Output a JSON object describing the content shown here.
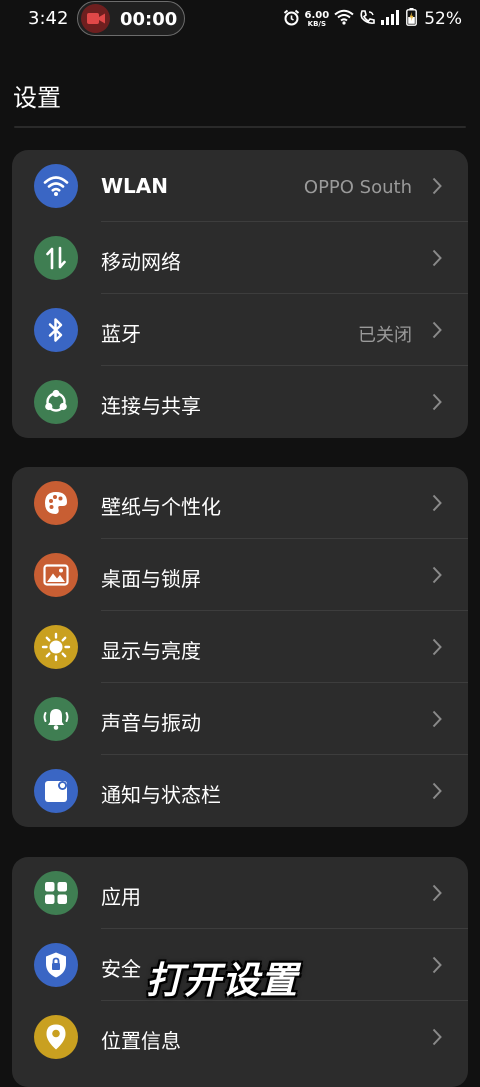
{
  "status_bar": {
    "time": "3:42",
    "recording_time": "00:00",
    "net_speed_value": "6.00",
    "net_speed_unit": "KB/S",
    "battery_percent": "52%",
    "icons": [
      "camera-record-icon",
      "alarm-icon",
      "wifi-signal-icon",
      "wifi-call-icon",
      "cellular-signal-icon",
      "battery-charging-icon"
    ]
  },
  "header": {
    "title": "设置"
  },
  "groups": [
    {
      "items": [
        {
          "label": "WLAN",
          "value": "OPPO South",
          "icon": "wifi-icon",
          "color": "#3a66c4"
        },
        {
          "label": "移动网络",
          "value": "",
          "icon": "mobile-data-icon",
          "color": "#3f7e52"
        },
        {
          "label": "蓝牙",
          "value": "已关闭",
          "icon": "bluetooth-icon",
          "color": "#3a66c4"
        },
        {
          "label": "连接与共享",
          "value": "",
          "icon": "share-icon",
          "color": "#3f7e52"
        }
      ]
    },
    {
      "items": [
        {
          "label": "壁纸与个性化",
          "value": "",
          "icon": "palette-icon",
          "color": "#c85e33"
        },
        {
          "label": "桌面与锁屏",
          "value": "",
          "icon": "picture-icon",
          "color": "#c85e33"
        },
        {
          "label": "显示与亮度",
          "value": "",
          "icon": "sun-icon",
          "color": "#c9a020"
        },
        {
          "label": "声音与振动",
          "value": "",
          "icon": "bell-vibrate-icon",
          "color": "#3f7e52"
        },
        {
          "label": "通知与状态栏",
          "value": "",
          "icon": "notification-icon",
          "color": "#3a66c4"
        }
      ]
    },
    {
      "items": [
        {
          "label": "应用",
          "value": "",
          "icon": "apps-grid-icon",
          "color": "#3f7e52"
        },
        {
          "label": "安全",
          "value": "",
          "icon": "shield-lock-icon",
          "color": "#3a66c4"
        },
        {
          "label": "位置信息",
          "value": "",
          "icon": "location-pin-icon",
          "color": "#c9a020"
        }
      ]
    }
  ],
  "overlay": {
    "caption": "打开设置"
  }
}
